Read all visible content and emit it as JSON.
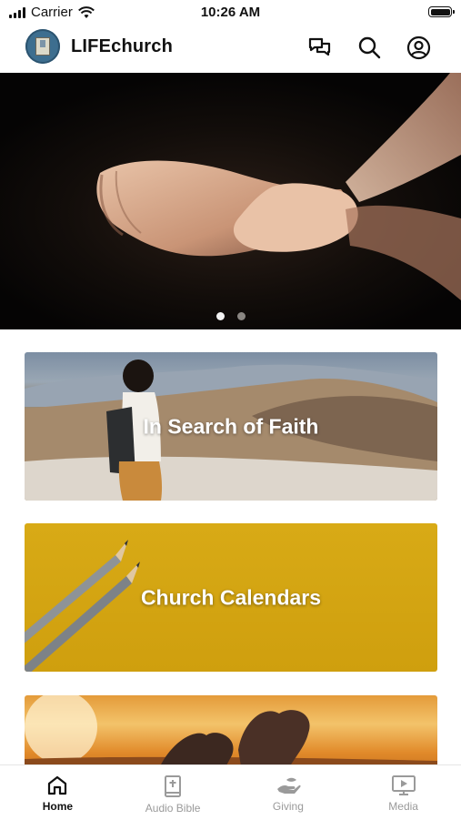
{
  "status_bar": {
    "carrier": "Carrier",
    "time": "10:26 AM"
  },
  "header": {
    "app_name": "LIFEchurch",
    "icons": [
      "chat-icon",
      "search-icon",
      "account-icon"
    ]
  },
  "hero": {
    "image": "hands-cupped-photo",
    "slide_count": 2,
    "active_slide": 1
  },
  "cards": [
    {
      "title": "In Search of Faith",
      "image": "woman-on-rocky-hill-photo"
    },
    {
      "title": "Church Calendars",
      "image": "pencils-on-yellow-photo"
    },
    {
      "title": "",
      "image": "hands-heart-sunset-photo"
    }
  ],
  "tab_bar": {
    "active": "Home",
    "tabs": [
      {
        "label": "Home",
        "icon": "home-icon"
      },
      {
        "label": "Audio Bible",
        "icon": "bible-icon"
      },
      {
        "label": "Giving",
        "icon": "giving-hand-icon"
      },
      {
        "label": "Media",
        "icon": "media-play-icon"
      }
    ]
  },
  "colors": {
    "text": "#111111",
    "tab_inactive": "#9a9a9a",
    "calendar_card": "#d8aa16"
  }
}
